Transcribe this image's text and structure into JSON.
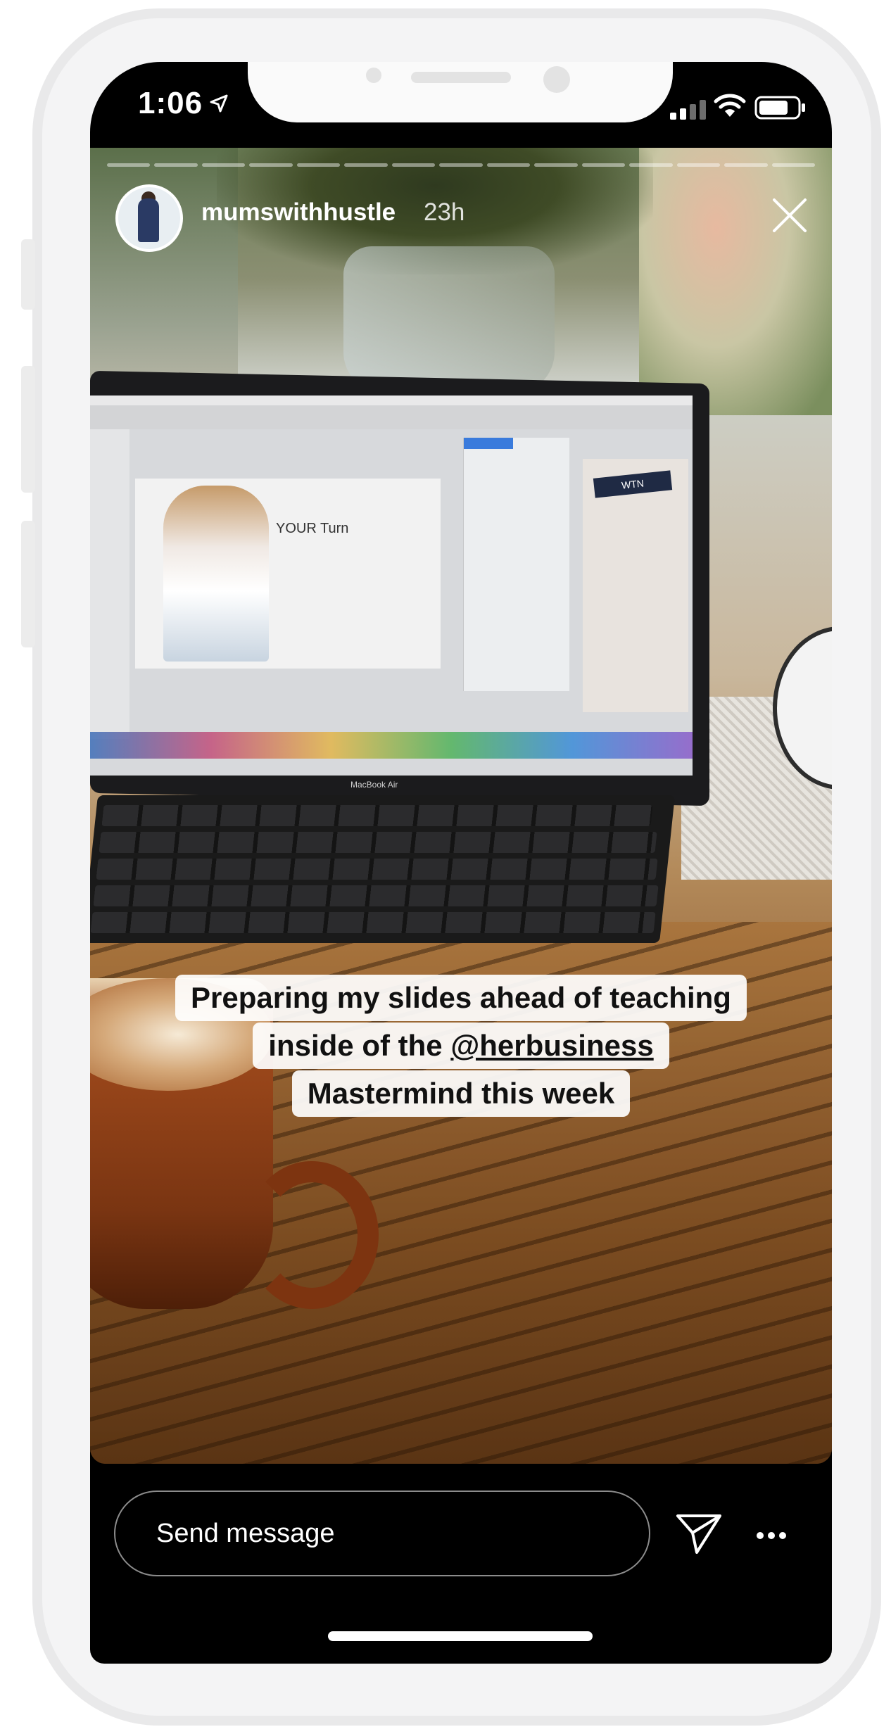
{
  "status_bar": {
    "time": "1:06"
  },
  "story": {
    "username": "mumswithhustle",
    "time_ago": "23h",
    "progress": {
      "segments": 15,
      "completed": 0
    },
    "caption": {
      "line1": "Preparing my slides ahead of teaching",
      "line2_prefix": "inside of the ",
      "line2_mention": "@herbusiness",
      "line3": "Mastermind this week"
    },
    "photo_text": {
      "slide_title": "YOUR Turn",
      "wtn_label": "WTN",
      "laptop_label": "MacBook Air"
    }
  },
  "footer": {
    "message_placeholder": "Send message"
  },
  "colors": {
    "background": "#000000",
    "text": "#ffffff",
    "caption_bg": "#ffffff"
  }
}
